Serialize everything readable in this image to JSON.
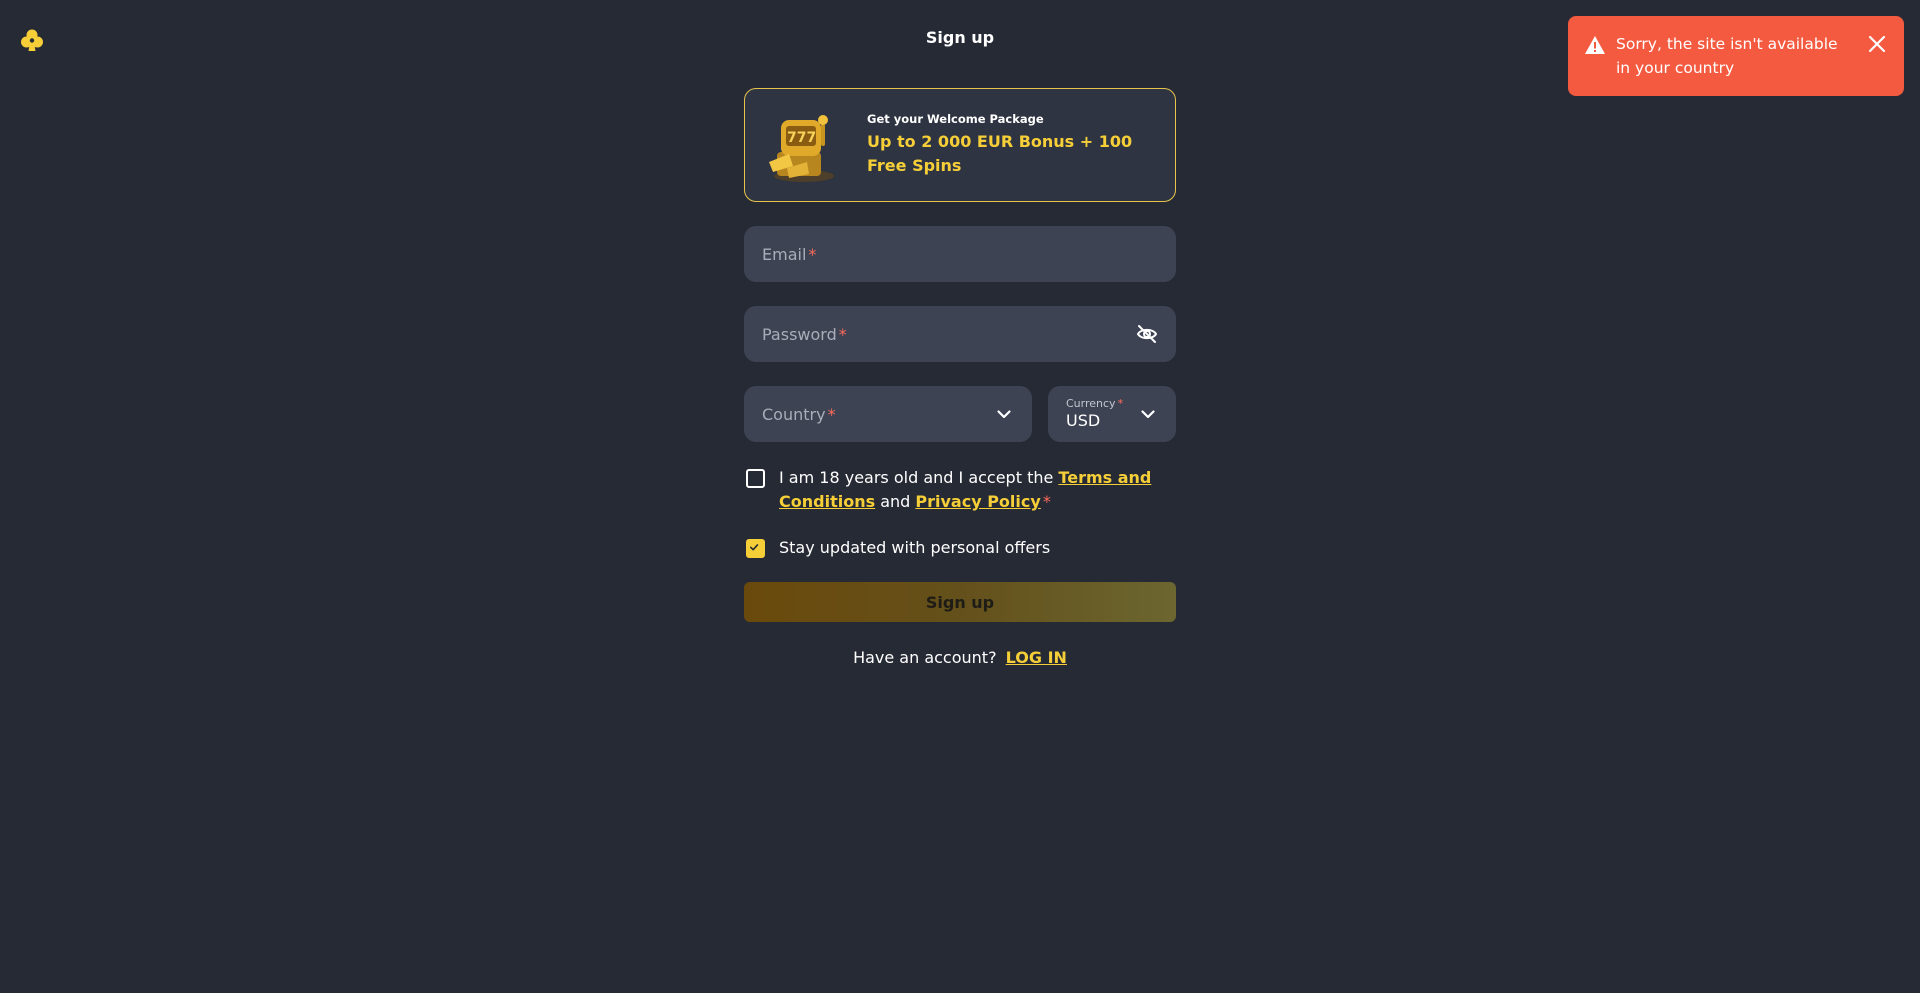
{
  "header": {
    "title": "Sign up",
    "logo_icon": "club-logo-icon"
  },
  "toast": {
    "message": "Sorry, the site isn't available in your country",
    "color": "#f45a40",
    "icon": "warning-icon",
    "close_icon": "close-icon"
  },
  "promo": {
    "kicker": "Get your Welcome Package",
    "offer": "Up to 2 000 EUR Bonus + 100 Free Spins",
    "image_icon": "slot-machine-icon"
  },
  "form": {
    "email": {
      "label": "Email",
      "required_mark": "*"
    },
    "password": {
      "label": "Password",
      "required_mark": "*",
      "toggle_icon": "eye-off-icon"
    },
    "country": {
      "label": "Country",
      "required_mark": "*"
    },
    "currency": {
      "label": "Currency",
      "required_mark": "*",
      "value": "USD"
    },
    "terms": {
      "checked": false,
      "text_before": "I am 18 years old and I accept the ",
      "terms_link": "Terms and Conditions",
      "text_mid": " and ",
      "privacy_link": "Privacy Policy",
      "required_mark": "*"
    },
    "offers": {
      "checked": true,
      "label": "Stay updated with personal offers"
    },
    "submit_label": "Sign up",
    "login_prompt": "Have an account?",
    "login_link": "LOG IN"
  },
  "colors": {
    "background": "#262a35",
    "accent": "#f6cf38",
    "field": "#3e4353",
    "required": "#ff6b5a"
  }
}
